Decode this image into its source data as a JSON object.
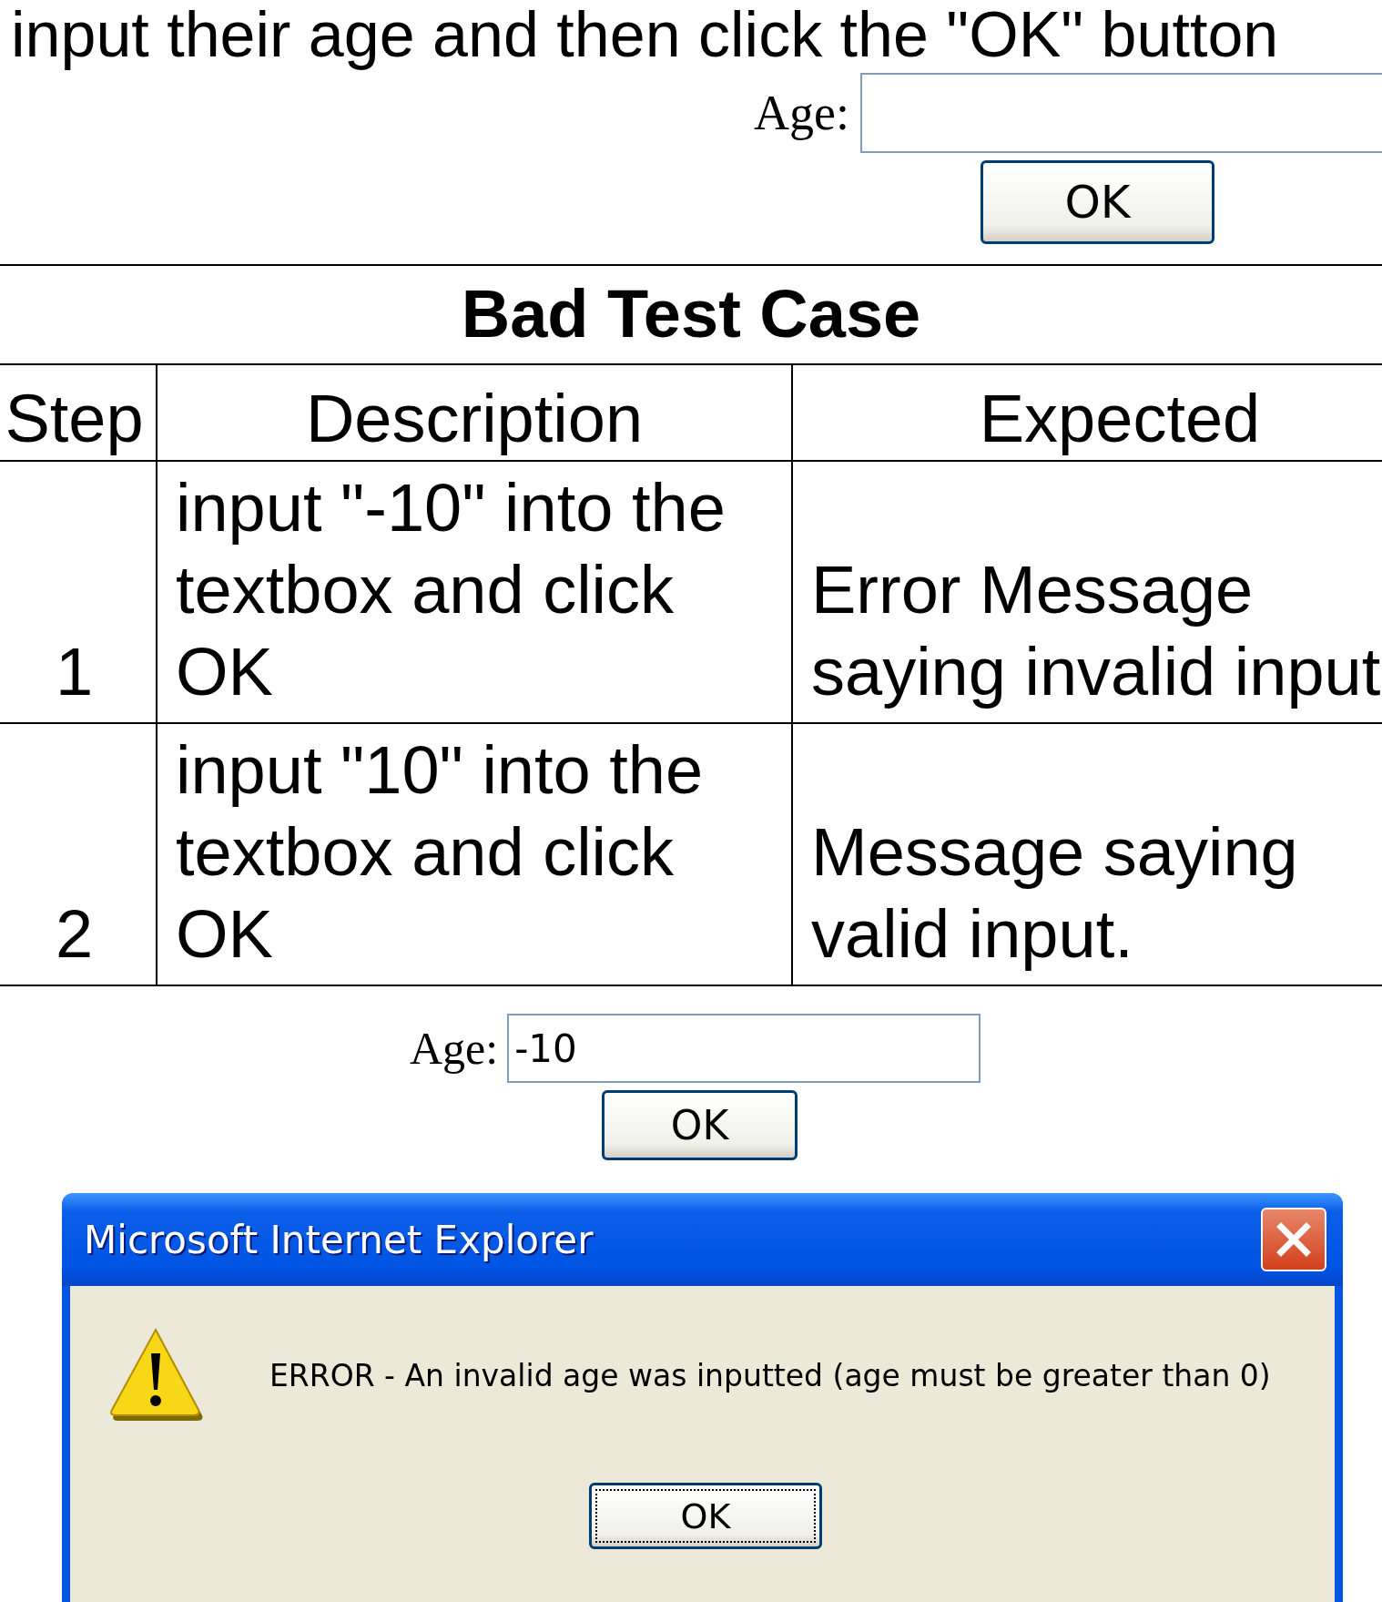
{
  "instruction": "input their age and then click the \"OK\" button",
  "top_form": {
    "label": "Age:",
    "button": "OK"
  },
  "table": {
    "title": "Bad Test Case",
    "columns": [
      "Step",
      "Description",
      "Expected"
    ],
    "rows": [
      {
        "step": "1",
        "description": "input \"-10\" into the textbox and click OK",
        "expected": "Error Message saying invalid input"
      },
      {
        "step": "2",
        "description": "input \"10\" into the textbox and click OK",
        "expected": "Message saying valid input."
      }
    ]
  },
  "bottom_form": {
    "label": "Age:",
    "value": "-10",
    "button": "OK"
  },
  "dialog": {
    "title": "Microsoft Internet Explorer",
    "message": "ERROR - An invalid age was inputted (age must be greater than 0)",
    "button": "OK"
  }
}
